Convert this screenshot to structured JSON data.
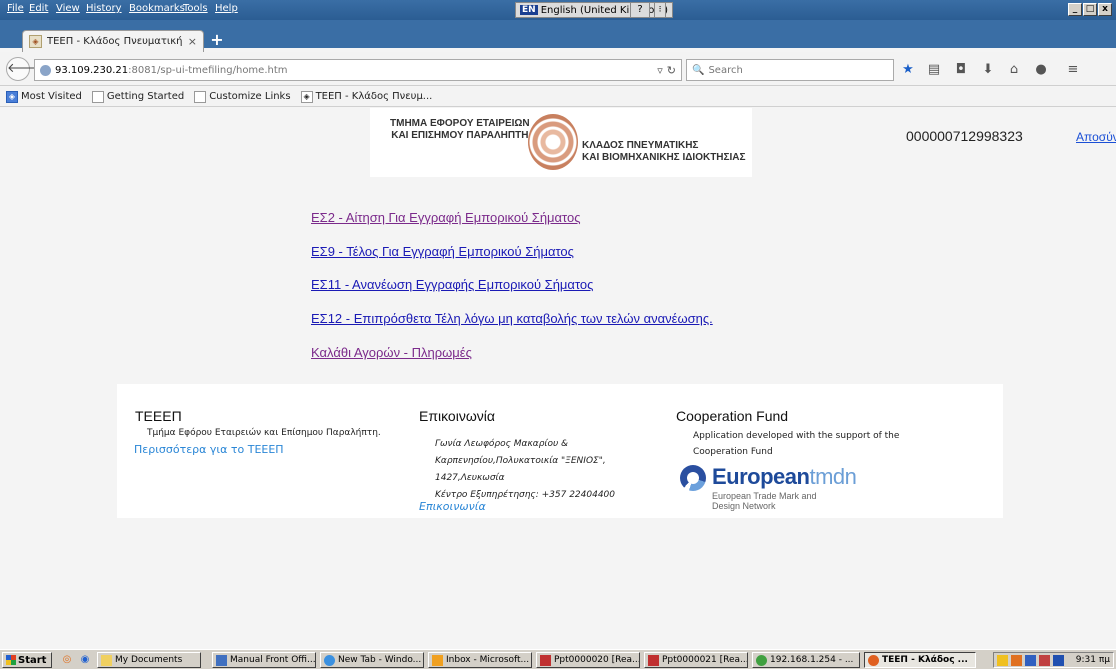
{
  "browser": {
    "menu": [
      "File",
      "Edit",
      "View",
      "History",
      "Bookmarks",
      "Tools",
      "Help"
    ],
    "language_indicator": {
      "code": "EN",
      "label": "English (United Kingdom)"
    },
    "help_label": "?",
    "window_buttons": [
      "_",
      "□",
      "x"
    ],
    "tab": {
      "title": "ΤΕΕΠ - Κλάδος Πνευματικής Ι...",
      "close": "×"
    },
    "new_tab": "+",
    "url": {
      "host": "93.109.230.21",
      "path": ":8081/sp-ui-tmefiling/home.htm"
    },
    "search_placeholder": "Search",
    "bookmarks": [
      "Most Visited",
      "Getting Started",
      "Customize Links",
      "ΤΕΕΠ - Κλάδος Πνευμ..."
    ]
  },
  "header": {
    "org_line1": "ΤΜΗΜΑ ΕΦΟΡΟΥ ΕΤΑΙΡΕΙΩΝ",
    "org_line2": "ΚΑΙ ΕΠΙΣΗΜΟΥ ΠΑΡΑΛΗΠΤΗ",
    "branch_line1": "ΚΛΑΔΟΣ ΠΝΕΥΜΑΤΙΚΗΣ",
    "branch_line2": "ΚΑΙ ΒΙΟΜΗΧΑΝΙΚΗΣ ΙΔΙΟΚΤΗΣΙΑΣ",
    "account_number": "000000712998323",
    "logout": "Αποσύνδεση"
  },
  "menu_links": [
    {
      "label": "ΕΣ2 - Αίτηση Για Εγγραφή Εμπορικού Σήματος",
      "visited": true
    },
    {
      "label": "ΕΣ9 - Τέλος Για Εγγραφή Εμπορικού Σήματος",
      "visited": false
    },
    {
      "label": "ΕΣ11 - Ανανέωση Εγγραφής Εμπορικού Σήματος",
      "visited": false
    },
    {
      "label": "ΕΣ12 - Επιπρόσθετα Τέλη λόγω μη καταβολής των τελών ανανέωσης.",
      "visited": false
    },
    {
      "label": "Καλάθι Αγορών - Πληρωμές",
      "visited": true
    }
  ],
  "footer": {
    "about": {
      "heading": "ΤΕΕΕΠ",
      "text": "Τμήμα Εφόρου Εταιρειών και Επίσημου Παραλήπτη.",
      "more_link": "Περισσότερα για το ΤΕΕΕΠ"
    },
    "contact": {
      "heading": "Επικοινωνία",
      "lines": [
        "Γωνία Λεωφόρος Μακαρίου &",
        "Καρπενησίου,Πολυκατοικία \"ΞΕΝΙΟΣ\",",
        "1427,Λευκωσία",
        "Κέντρο Εξυπηρέτησης: +357 22404400"
      ],
      "link": "Επικοινωνία"
    },
    "cooperation": {
      "heading": "Cooperation Fund",
      "text_line1": "Application developed with the support of the",
      "text_line2": "Cooperation Fund",
      "logo_bold": "European",
      "logo_light": "tmdn",
      "logo_sub1": "European Trade Mark and",
      "logo_sub2": "Design Network"
    }
  },
  "taskbar": {
    "start": "Start",
    "items": [
      {
        "label": "My Documents",
        "active": false
      },
      {
        "label": "Manual Front Offi...",
        "active": false
      },
      {
        "label": "New Tab - Windo...",
        "active": false
      },
      {
        "label": "Inbox - Microsoft...",
        "active": false
      },
      {
        "label": "Ppt0000020 [Rea...",
        "active": false
      },
      {
        "label": "Ppt0000021 [Rea...",
        "active": false
      },
      {
        "label": "192.168.1.254 - ...",
        "active": false
      },
      {
        "label": "ΤΕΕΠ - Κλάδος ...",
        "active": true
      }
    ],
    "clock": "9:31 πμ"
  },
  "colors": {
    "link_visited": "#7b2a8b",
    "link_unvisited": "#1a1ab5",
    "footer_link": "#2a86d6",
    "titlebar": "#3a6ea5",
    "tmdn_blue": "#1e4a9a"
  }
}
